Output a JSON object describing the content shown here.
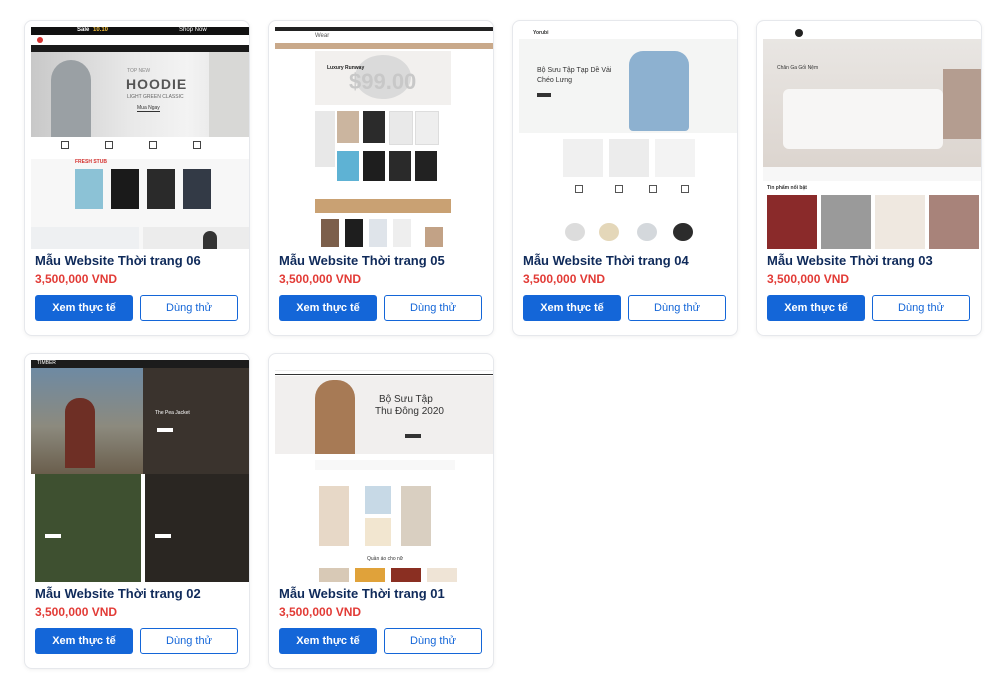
{
  "colors": {
    "primary": "#1466d8",
    "price": "#e23b36",
    "title": "#0f2a5a"
  },
  "cards": [
    {
      "title": "Mẫu Website Thời trang 06",
      "price": "3,500,000 VND",
      "view_label": "Xem thực tế",
      "try_label": "Dùng thử",
      "thumb": {
        "sale_a": "Sale",
        "sale_b": "10.10",
        "shop_now": "Shop Now",
        "brand": "Hoodie",
        "headline": "HOODIE",
        "sub": "LIGHT GREEN CLASSIC",
        "top": "TOP NEW",
        "cta": "Mua Ngay",
        "section": "FRESH STUB"
      }
    },
    {
      "title": "Mẫu Website Thời trang 05",
      "price": "3,500,000 VND",
      "view_label": "Xem thực tế",
      "try_label": "Dùng thử",
      "thumb": {
        "logo": "Wear",
        "sale": "Luxury Runway",
        "big": "$99.00"
      }
    },
    {
      "title": "Mẫu Website Thời trang 04",
      "price": "3,500,000 VND",
      "view_label": "Xem thực tế",
      "try_label": "Dùng thử",
      "thumb": {
        "logo": "Yorubi",
        "heading1": "Bộ Sưu Tập Tạp Dề Vải",
        "heading2": "Chéo Lưng"
      }
    },
    {
      "title": "Mẫu Website Thời trang 03",
      "price": "3,500,000 VND",
      "view_label": "Xem thực tế",
      "try_label": "Dùng thử",
      "thumb": {
        "heading": "Chăn Ga Gối Nệm",
        "section": "Tin phẩm nổi bật"
      }
    },
    {
      "title": "Mẫu Website Thời trang 02",
      "price": "3,500,000 VND",
      "view_label": "Xem thực tế",
      "try_label": "Dùng thử",
      "thumb": {
        "logo": "TIMBER",
        "jacket": "The Pea Jacket"
      }
    },
    {
      "title": "Mẫu Website Thời trang 01",
      "price": "3,500,000 VND",
      "view_label": "Xem thực tế",
      "try_label": "Dùng thử",
      "thumb": {
        "heading1": "Bộ Sưu Tập",
        "heading2": "Thu Đông 2020",
        "section": "Quần áo cho nữ"
      }
    }
  ]
}
